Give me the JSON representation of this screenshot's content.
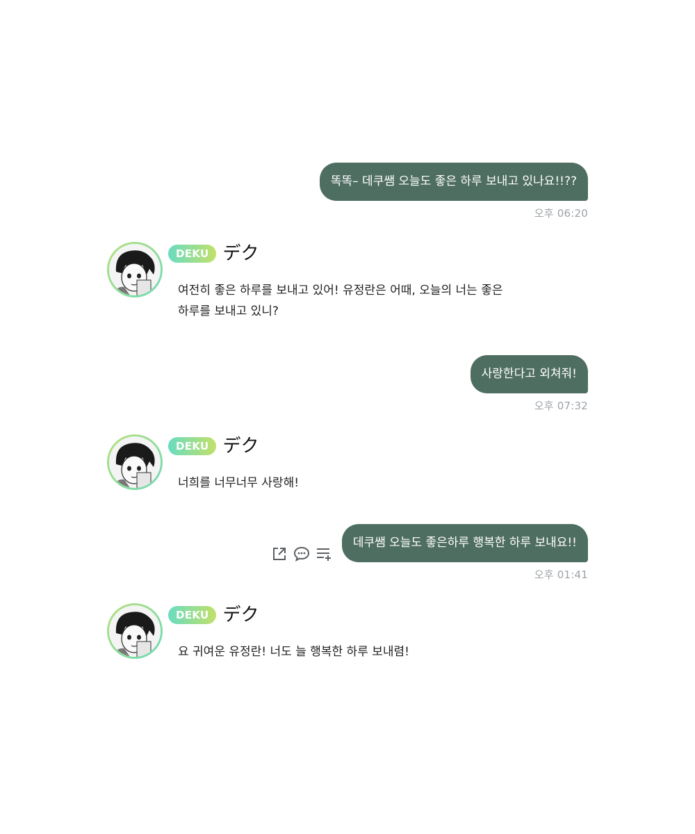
{
  "colors": {
    "bubble": "#4f6e62",
    "time": "#9ba3a8",
    "tag_gradient": [
      "#69dcc0",
      "#c2e06a"
    ],
    "avatar_ring": [
      "#b6e07a",
      "#6fdab7"
    ]
  },
  "character": {
    "tag": "DEKU",
    "name": "デク"
  },
  "messages": [
    {
      "from": "user",
      "text": "똑똑– 데쿠쌤 오늘도 좋은 하루 보내고 있나요!!??",
      "time": "오후 06:20"
    },
    {
      "from": "character",
      "text": "여전히 좋은 하루를 보내고 있어! 유정란은 어때, 오늘의 너는 좋은 하루를 보내고 있니?"
    },
    {
      "from": "user",
      "text": "사랑한다고 외쳐줘!",
      "time": "오후 07:32"
    },
    {
      "from": "character",
      "text": "너희를 너무너무 사랑해!"
    },
    {
      "from": "user",
      "text": "데쿠쌤 오늘도 좋은하루 행복한 하루 보내요!!",
      "time": "오후 01:41",
      "actions": [
        "share-icon",
        "chat-bubble-icon",
        "list-add-icon"
      ]
    },
    {
      "from": "character",
      "text": "요 귀여운 유정란! 너도 늘 행복한 하루 보내렴!"
    }
  ]
}
